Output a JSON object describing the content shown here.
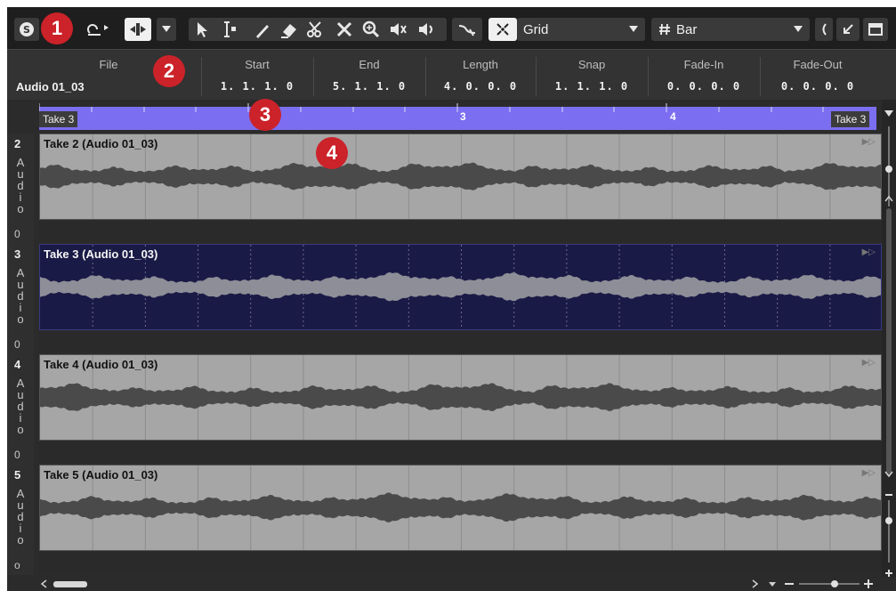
{
  "toolbar": {
    "snap_mode": "Grid",
    "snap_icon": "snap-grid-icon",
    "quantize": "Bar",
    "quantize_icon": "hash-icon"
  },
  "infoline": {
    "file": {
      "label": "File",
      "value": "Audio 01_03"
    },
    "start": {
      "label": "Start",
      "value": "1. 1. 1.   0"
    },
    "end": {
      "label": "End",
      "value": "5. 1. 1.   0"
    },
    "length": {
      "label": "Length",
      "value": "4. 0. 0.   0"
    },
    "snap": {
      "label": "Snap",
      "value": "1. 1. 1.   0"
    },
    "fade_in": {
      "label": "Fade-In",
      "value": "0. 0. 0.   0"
    },
    "fade_out": {
      "label": "Fade-Out",
      "value": "0. 0. 0.   0"
    }
  },
  "ruler": {
    "left_label": "Take 3",
    "right_label": "Take 3",
    "markers": [
      "3",
      "4"
    ]
  },
  "lanes": [
    {
      "number": "2",
      "type_label": "A u d i o",
      "value": "0",
      "title": "Take 2 (Audio 01_03)"
    },
    {
      "number": "3",
      "type_label": "A u d i o",
      "value": "0",
      "title": "Take 3 (Audio 01_03)"
    },
    {
      "number": "4",
      "type_label": "A u d i o",
      "value": "0",
      "title": "Take 4 (Audio 01_03)"
    },
    {
      "number": "5",
      "type_label": "A u d i o",
      "value": "o",
      "title": "Take 5 (Audio 01_03)"
    }
  ],
  "callouts": [
    "1",
    "2",
    "3",
    "4"
  ],
  "colors": {
    "ruler_accent": "#7b6ef0",
    "selected_lane_bg": "#1a1a46",
    "lane_bg": "#a6a6a6",
    "waveform": "#4a4a4a",
    "callout": "#cc2229"
  }
}
